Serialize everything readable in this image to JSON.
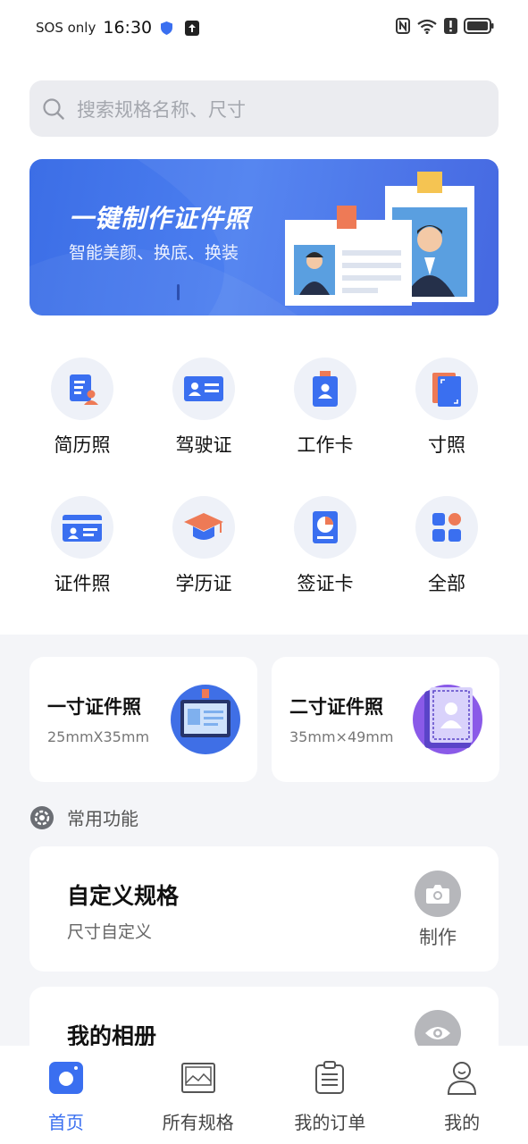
{
  "status_bar": {
    "carrier": "SOS only",
    "time": "16:30"
  },
  "search": {
    "placeholder": "搜索规格名称、尺寸"
  },
  "banner": {
    "title": "一键制作证件照",
    "subtitle": "智能美颜、换底、换装"
  },
  "categories": [
    {
      "label": "简历照",
      "icon": "resume-icon"
    },
    {
      "label": "驾驶证",
      "icon": "driver-license-icon"
    },
    {
      "label": "工作卡",
      "icon": "work-badge-icon"
    },
    {
      "label": "寸照",
      "icon": "inch-photo-icon"
    },
    {
      "label": "证件照",
      "icon": "id-card-icon"
    },
    {
      "label": "学历证",
      "icon": "graduation-cap-icon"
    },
    {
      "label": "签证卡",
      "icon": "visa-icon"
    },
    {
      "label": "全部",
      "icon": "all-grid-icon"
    }
  ],
  "size_cards": [
    {
      "title": "一寸证件照",
      "size": "25mmX35mm"
    },
    {
      "title": "二寸证件照",
      "size": "35mm×49mm"
    }
  ],
  "common": {
    "title": "常用功能",
    "custom": {
      "title": "自定义规格",
      "subtitle": "尺寸自定义",
      "action": "制作"
    },
    "album": {
      "title": "我的相册"
    }
  },
  "nav": {
    "items": [
      {
        "label": "首页",
        "active": true
      },
      {
        "label": "所有规格",
        "active": false
      },
      {
        "label": "我的订单",
        "active": false
      },
      {
        "label": "我的",
        "active": false
      }
    ]
  },
  "colors": {
    "accent": "#3a6ff0",
    "banner": "#4c7ff0",
    "page_bg": "#f4f5f8"
  }
}
